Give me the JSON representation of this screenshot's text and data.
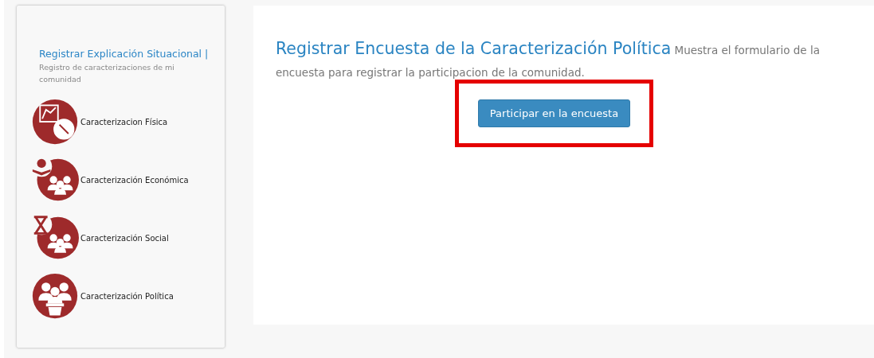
{
  "sidebar": {
    "title": "Registrar Explicación Situacional |",
    "subtitle": "Registro de caracterizaciones de mi comunidad",
    "items": [
      {
        "kind": "physical",
        "label": "Caracterizacion Física"
      },
      {
        "kind": "economic",
        "label": "Caracterización Económica"
      },
      {
        "kind": "social",
        "label": "Caracterización Social"
      },
      {
        "kind": "political",
        "label": "Caracterización Política"
      }
    ]
  },
  "main": {
    "title": "Registrar Encuesta de la Caracterización Política",
    "description": "Muestra el formulario de la encuesta para registrar la participacion de la comunidad.",
    "button": {
      "label": "Participar en la encuesta",
      "highlighted": true
    }
  }
}
